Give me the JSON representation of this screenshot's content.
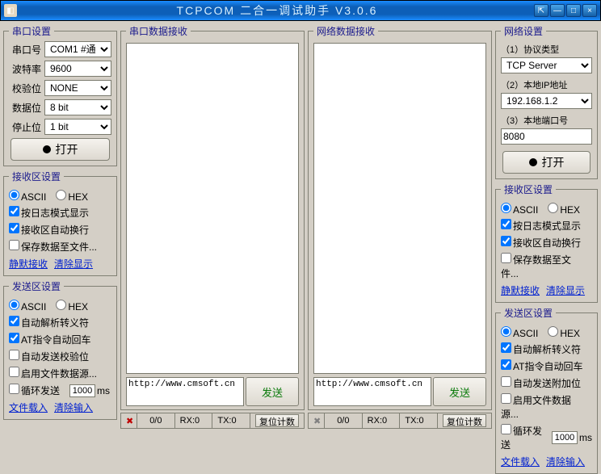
{
  "window": {
    "title": "TCPCOM 二合一调试助手   V3.0.6"
  },
  "serial": {
    "legend": "串口设置",
    "port_label": "串口号",
    "port_value": "COM1 #通",
    "baud_label": "波特率",
    "baud_value": "9600",
    "check_label": "校验位",
    "check_value": "NONE",
    "data_label": "数据位",
    "data_value": "8 bit",
    "stop_label": "停止位",
    "stop_value": "1 bit",
    "open_btn": "打开"
  },
  "recv": {
    "legend": "接收区设置",
    "ascii": "ASCII",
    "hex": "HEX",
    "log_mode": "按日志模式显示",
    "auto_wrap": "接收区自动换行",
    "save_file": "保存数据至文件...",
    "mute_link": "静默接收",
    "clear_link": "清除显示"
  },
  "send": {
    "legend": "发送区设置",
    "ascii": "ASCII",
    "hex": "HEX",
    "auto_escape": "自动解析转义符",
    "at_cr": "AT指令自动回车",
    "auto_checksum": "自动发送校验位",
    "file_source": "启用文件数据源...",
    "loop": "循环发送",
    "loop_ms": "1000",
    "ms_unit": "ms",
    "load_link": "文件载入",
    "clear_link": "清除输入"
  },
  "net": {
    "legend": "网络设置",
    "proto_label": "（1）协议类型",
    "proto_value": "TCP Server",
    "ip_label": "（2）本地IP地址",
    "ip_value": "192.168.1.2",
    "port_label": "（3）本地端口号",
    "port_value": "8080",
    "open_btn": "打开"
  },
  "net_recv": {
    "legend": "接收区设置",
    "ascii": "ASCII",
    "hex": "HEX",
    "log_mode": "按日志模式显示",
    "auto_wrap": "接收区自动换行",
    "save_file": "保存数据至文件...",
    "mute_link": "静默接收",
    "clear_link": "清除显示"
  },
  "net_send": {
    "legend": "发送区设置",
    "ascii": "ASCII",
    "hex": "HEX",
    "auto_escape": "自动解析转义符",
    "at_cr": "AT指令自动回车",
    "auto_addon": "自动发送附加位",
    "file_source": "启用文件数据源...",
    "loop": "循环发送",
    "loop_ms": "1000",
    "ms_unit": "ms",
    "load_link": "文件载入",
    "clear_link": "清除输入"
  },
  "center": {
    "serial_recv_legend": "串口数据接收",
    "net_recv_legend": "网络数据接收",
    "send_btn": "发送",
    "send_text": "http://www.cmsoft.cn"
  },
  "status": {
    "count": "0/0",
    "rx": "RX:0",
    "tx": "TX:0",
    "reset": "复位计数"
  }
}
